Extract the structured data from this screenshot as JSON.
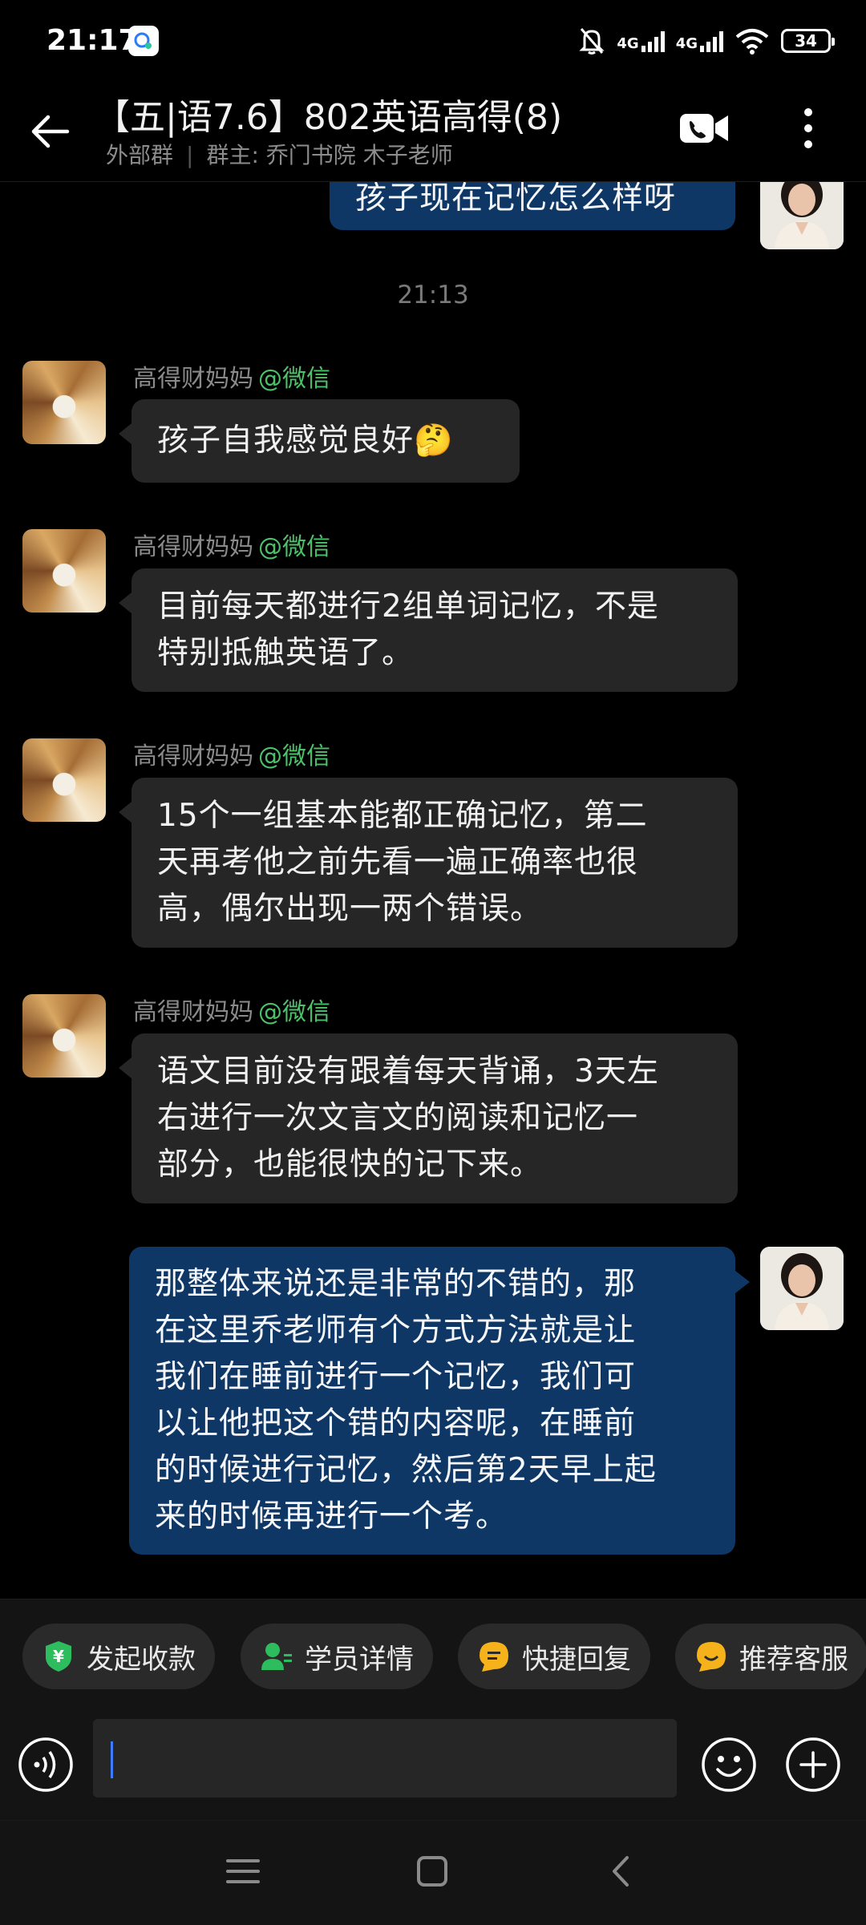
{
  "status_bar": {
    "time": "21:17",
    "network_1": "4G",
    "network_2": "4G",
    "battery": "34"
  },
  "header": {
    "title": "【五|语7.6】802英语高得(8)",
    "group_type": "外部群",
    "owner": "群主: 乔门书院 木子老师"
  },
  "chat": {
    "top_partial_message": "孩子现在记忆怎么样呀",
    "time_divider": "21:13",
    "messages": [
      {
        "sender": "高得财妈妈",
        "source": "@微信",
        "text": "孩子自我感觉良好🤔"
      },
      {
        "sender": "高得财妈妈",
        "source": "@微信",
        "lines": [
          "目前每天都进行2组单词记忆，不是",
          "特别抵触英语了。"
        ]
      },
      {
        "sender": "高得财妈妈",
        "source": "@微信",
        "lines": [
          "15个一组基本能都正确记忆，第二",
          "天再考他之前先看一遍正确率也很",
          "高，偶尔出现一两个错误。"
        ]
      },
      {
        "sender": "高得财妈妈",
        "source": "@微信",
        "lines": [
          "语文目前没有跟着每天背诵，3天左",
          "右进行一次文言文的阅读和记忆一",
          "部分，也能很快的记下来。"
        ]
      }
    ],
    "outgoing": {
      "lines": [
        "那整体来说还是非常的不错的，那",
        "在这里乔老师有个方式方法就是让",
        "我们在睡前进行一个记忆，我们可",
        "以让他把这个错的内容呢，在睡前",
        "的时候进行记忆，然后第2天早上起",
        "来的时候再进行一个考。"
      ]
    }
  },
  "quick_actions": [
    {
      "label": "发起收款",
      "icon": "payment-shield-icon",
      "color": "#2dbd5f"
    },
    {
      "label": "学员详情",
      "icon": "student-profile-icon",
      "color": "#2dbd5f"
    },
    {
      "label": "快捷回复",
      "icon": "quick-reply-icon",
      "color": "#f5b21b"
    },
    {
      "label": "推荐客服",
      "icon": "recommend-service-icon",
      "color": "#f5b21b"
    }
  ],
  "input": {
    "value": ""
  },
  "colors": {
    "outgoing_bubble": "#0f3765",
    "incoming_bubble": "#262626",
    "wechat_tag": "#4cc16a",
    "background": "#000000"
  }
}
